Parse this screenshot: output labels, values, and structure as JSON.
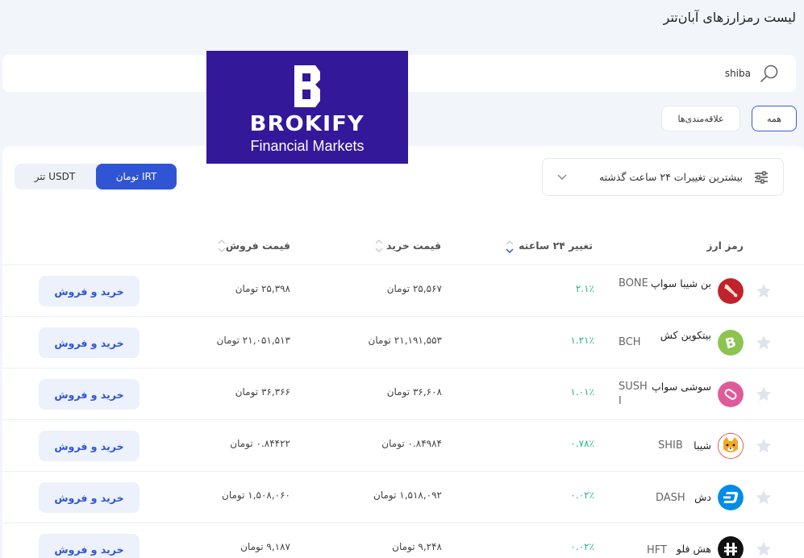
{
  "page": {
    "title": "لیست رمزارزهای آبان‌تتر"
  },
  "search": {
    "value": "shiba",
    "icon": "search-icon"
  },
  "filters": {
    "all_label": "همه",
    "favorites_label": "علاقه‌مندی‌ها"
  },
  "logo": {
    "word": "BROKIFY",
    "subtitle": "Financial Markets",
    "bg_color": "#34189a"
  },
  "sort": {
    "label": "بیشترین تغییرات ۲۴ ساعت گذشته"
  },
  "currency": {
    "irt_label": "تومان IRT",
    "usdt_label": "تتر USDT",
    "active": "IRT",
    "accent": "#2f55d4"
  },
  "table": {
    "headers": {
      "symbol": "رمز ارز",
      "change": "تغییر ۲۴ ساعته",
      "buy": "قیمت خرید",
      "sell": "قیمت فروش"
    },
    "rows": [
      {
        "name": "بن شیبا سواپ",
        "symbol": "BONE",
        "change": "۲.۱٪",
        "buy": "۲۵,۵۶۷ تومان",
        "sell": "۲۵,۳۹۸ تومان",
        "action": "خرید و فروش",
        "icon": "bone-coin-icon"
      },
      {
        "name": "بیتکوین کش",
        "symbol": "BCH",
        "change": "۱.۲۱٪",
        "buy": "۲۱,۱۹۱,۵۵۳ تومان",
        "sell": "۲۱,۰۵۱,۵۱۳ تومان",
        "action": "خرید و فروش",
        "icon": "bch-coin-icon"
      },
      {
        "name": "سوشی سواپ",
        "symbol": "SUSHI",
        "change": "۱.۰۱٪",
        "buy": "۳۶,۶۰۸ تومان",
        "sell": "۳۶,۳۶۶ تومان",
        "action": "خرید و فروش",
        "icon": "sushi-coin-icon"
      },
      {
        "name": "شیبا",
        "symbol": "SHIB",
        "change": "۰.۷۸٪",
        "buy": "۰.۸۴۹۸۴ تومان",
        "sell": "۰.۸۴۴۲۲ تومان",
        "action": "خرید و فروش",
        "icon": "shib-coin-icon"
      },
      {
        "name": "دش",
        "symbol": "DASH",
        "change": "۰.۰۲٪",
        "buy": "۱,۵۱۸,۰۹۲ تومان",
        "sell": "۱,۵۰۸,۰۶۰ تومان",
        "action": "خرید و فروش",
        "icon": "dash-coin-icon"
      },
      {
        "name": "هش فلو",
        "symbol": "HFT",
        "change": "۰.۰۲٪",
        "buy": "۹,۲۴۸ تومان",
        "sell": "۹,۱۸۷ تومان",
        "action": "خرید و فروش",
        "icon": "hft-coin-icon"
      }
    ]
  }
}
